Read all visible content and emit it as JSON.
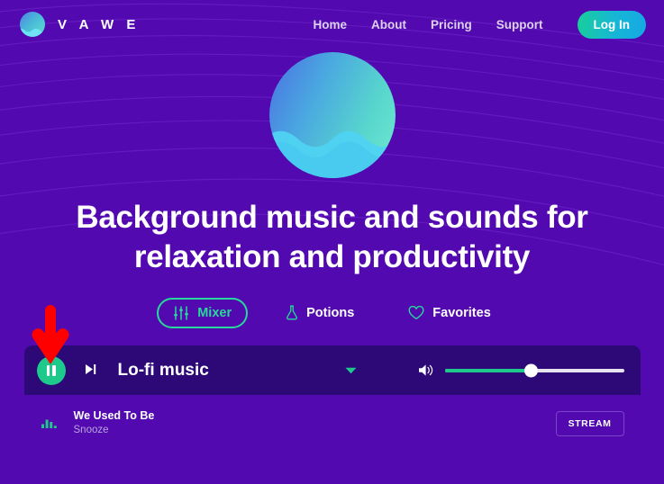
{
  "theme": {
    "background": "#5209b0",
    "accent_green": "#1ec98c",
    "tab_active_green": "#27d99a",
    "player_bar_bg": "#2d0877",
    "annotation_red": "#ff0000"
  },
  "navbar": {
    "brand_name": "V A W E",
    "brand_icon": "wave-orb-logo",
    "links": [
      {
        "label": "Home"
      },
      {
        "label": "About"
      },
      {
        "label": "Pricing"
      },
      {
        "label": "Support"
      }
    ],
    "login_label": "Log In"
  },
  "hero": {
    "orb_icon": "wave-orb-graphic",
    "title": "Background music and sounds for relaxation and productivity"
  },
  "tabs": [
    {
      "label": "Mixer",
      "icon": "sliders-icon",
      "active": true
    },
    {
      "label": "Potions",
      "icon": "flask-icon",
      "active": false
    },
    {
      "label": "Favorites",
      "icon": "heart-icon",
      "active": false
    }
  ],
  "player": {
    "play_state_icon": "pause-icon",
    "next_icon": "skip-next-icon",
    "title": "Lo-fi music",
    "collapse_icon": "chevron-down-icon",
    "volume_icon": "speaker-icon",
    "volume_percent": 48
  },
  "tracks": [
    {
      "icon": "equalizer-icon",
      "name": "We Used To Be",
      "artist": "Snooze",
      "action_label": "STREAM"
    }
  ],
  "annotation": {
    "type": "down-arrow",
    "color": "#ff0000"
  }
}
